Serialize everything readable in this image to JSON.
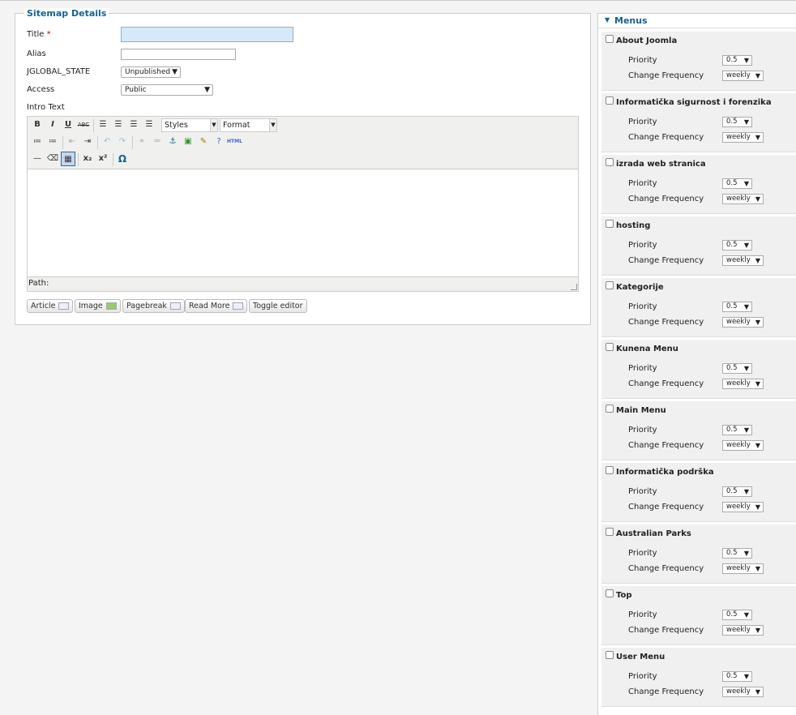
{
  "fieldset": {
    "legend": "Sitemap Details"
  },
  "form": {
    "title_label": "Title",
    "required_mark": "*",
    "alias_label": "Alias",
    "state_label": "JGLOBAL_STATE",
    "state_value": "Unpublished",
    "access_label": "Access",
    "access_value": "Public",
    "intro_label": "Intro Text"
  },
  "editor": {
    "styles": "Styles",
    "format": "Format",
    "path_label": "Path:",
    "toolbar1": [
      "B",
      "I",
      "U",
      "ABC"
    ],
    "html_icon": "HTML",
    "buttons": [
      "Article",
      "Image",
      "Pagebreak",
      "Read More",
      "Toggle editor"
    ]
  },
  "menus": {
    "header": "Menus",
    "priority_label": "Priority",
    "freq_label": "Change Frequency",
    "items": [
      {
        "name": "About Joomla",
        "priority": "0.5",
        "freq": "weekly"
      },
      {
        "name": "Informatička sigurnost i forenzika",
        "priority": "0.5",
        "freq": "weekly"
      },
      {
        "name": "izrada web stranica",
        "priority": "0.5",
        "freq": "weekly"
      },
      {
        "name": "hosting",
        "priority": "0.5",
        "freq": "weekly"
      },
      {
        "name": "Kategorije",
        "priority": "0.5",
        "freq": "weekly"
      },
      {
        "name": "Kunena Menu",
        "priority": "0.5",
        "freq": "weekly"
      },
      {
        "name": "Main Menu",
        "priority": "0.5",
        "freq": "weekly"
      },
      {
        "name": "Informatička podrška",
        "priority": "0.5",
        "freq": "weekly"
      },
      {
        "name": "Australian Parks",
        "priority": "0.5",
        "freq": "weekly"
      },
      {
        "name": "Top",
        "priority": "0.5",
        "freq": "weekly"
      },
      {
        "name": "User Menu",
        "priority": "0.5",
        "freq": "weekly"
      }
    ]
  }
}
